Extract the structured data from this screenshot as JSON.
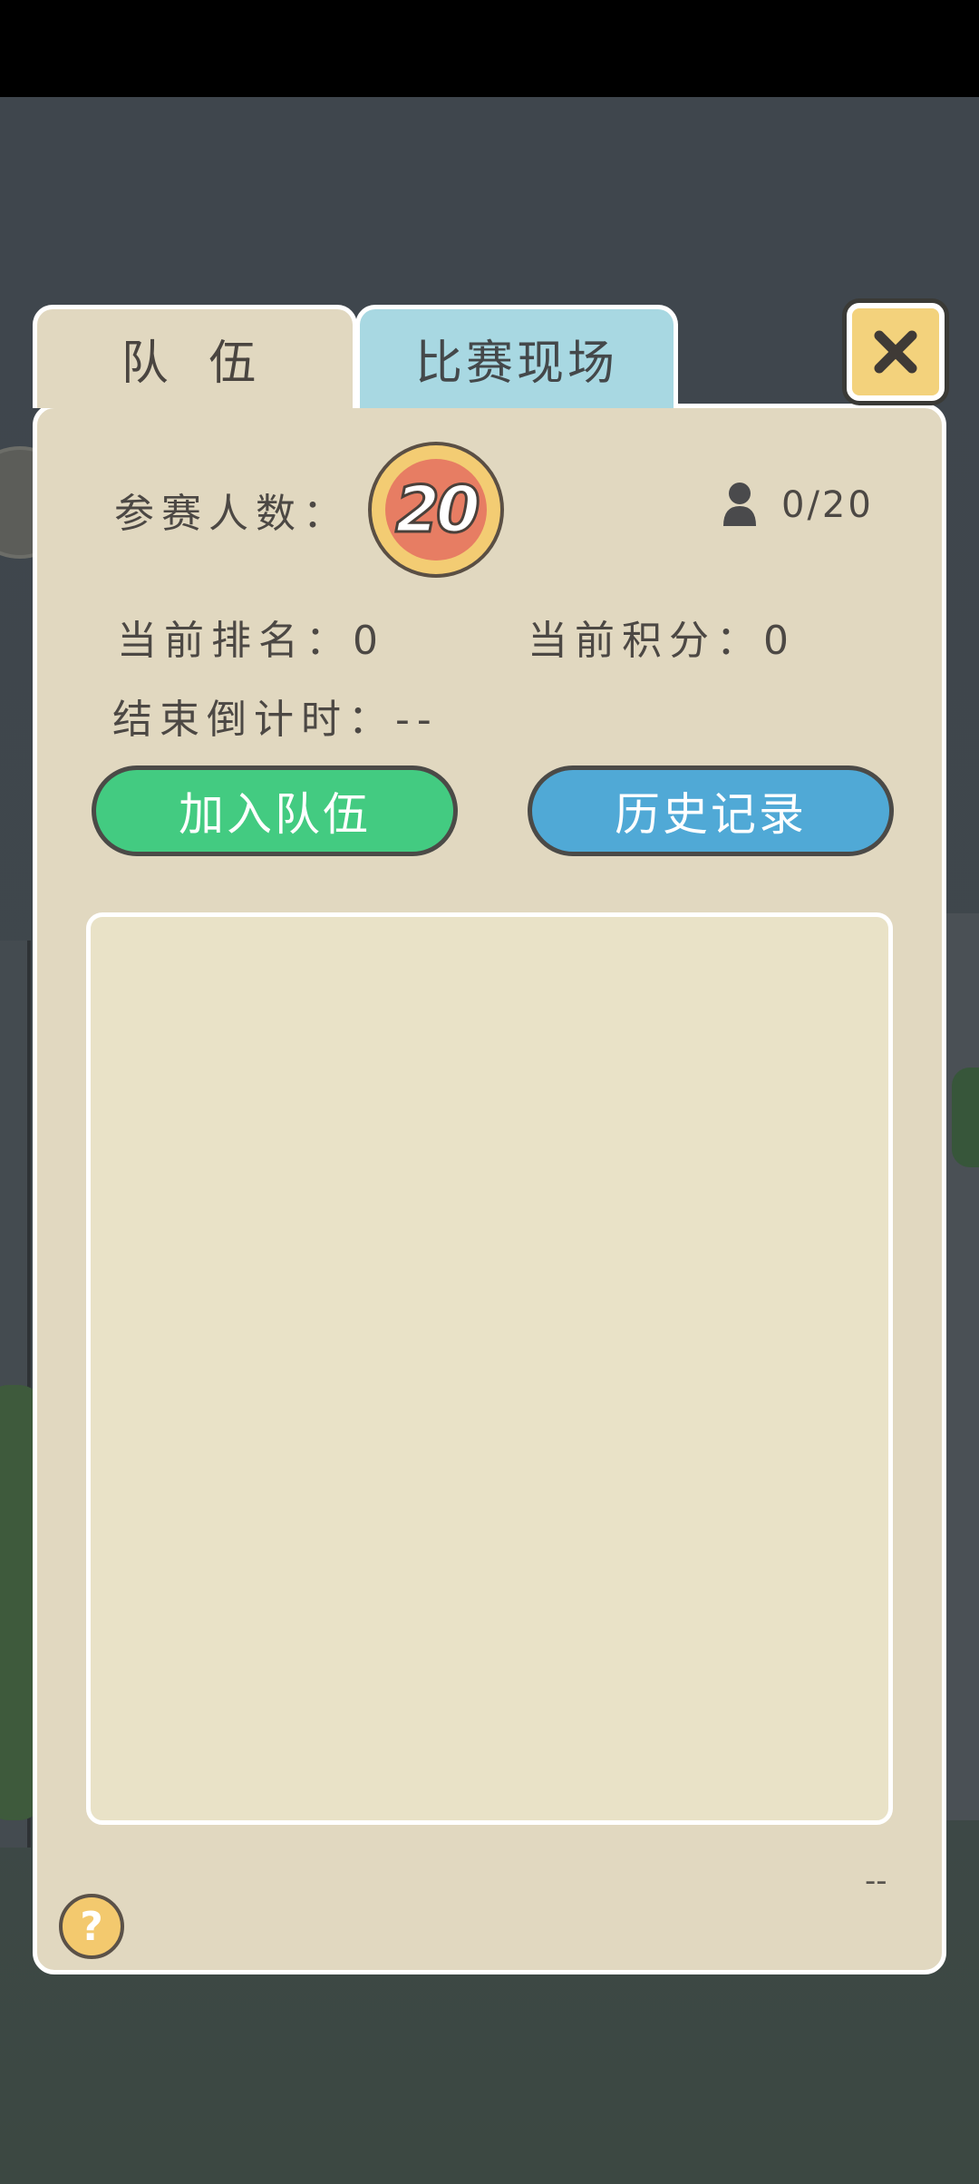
{
  "tabs": [
    {
      "label": "队 伍",
      "active": true
    },
    {
      "label": "比赛现场",
      "active": false
    }
  ],
  "contest": {
    "participants_label": "参赛人数：",
    "participants_badge": "20",
    "members": "0/20",
    "rank_label": "当前排名：0",
    "score_label": "当前积分：0",
    "countdown_label": "结束倒计时：--"
  },
  "actions": {
    "join_team": "加入队伍",
    "history": "历史记录"
  },
  "footer": {
    "dash": "--",
    "help": "?"
  },
  "colors": {
    "panel": "#e1d8c0",
    "join_button": "#43cb81",
    "history_button": "#50a9d6",
    "active_tab": "#e1d8c0",
    "inactive_tab": "#a8d8e2",
    "close_button": "#f3d27c"
  },
  "icons": {
    "close": "close-icon",
    "members": "person-icon",
    "help": "question-icon"
  }
}
